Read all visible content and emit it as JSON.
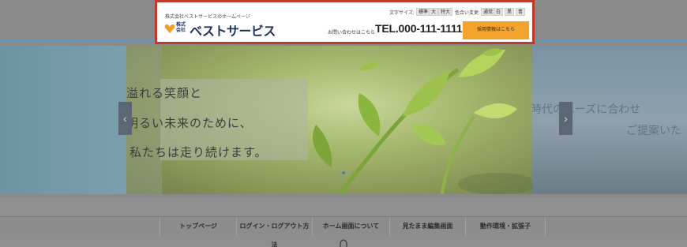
{
  "header": {
    "tagline": "株式会社ベストサービスのホームページ",
    "logo_kaisha": "株式\n会社",
    "logo_name": "ベストサービス",
    "font_size_label": "文字サイズ:",
    "font_sizes": [
      "標準",
      "大",
      "特大"
    ],
    "color_label": "色合い変更:",
    "colors": [
      "通常",
      "白",
      "黒",
      "青"
    ],
    "contact_text": "お問い合わせはこちら",
    "tel": "TEL.000-111-1111",
    "recruit_button": "採用情報はこちら"
  },
  "hero": {
    "lines": [
      "溢れる笑顔と",
      "明るい未来のために、",
      "私たちは走り続けます。"
    ],
    "right_lines": [
      "時代のニーズに合わせ",
      "ご提案いた"
    ],
    "prev_arrow": "‹",
    "next_arrow": "›",
    "slide_count": 3,
    "active_slide": 2
  },
  "nav": {
    "items": [
      "トップページ",
      "ログイン・ログアウト方法",
      "ホーム画面について",
      "見たまま編集画面",
      "動作環境・拡張子"
    ]
  },
  "colors": {
    "highlight_border": "#c0392b",
    "brand_navy": "#23315e",
    "recruit_orange": "#f3a22c",
    "logo_orange": "#f0a02a"
  }
}
